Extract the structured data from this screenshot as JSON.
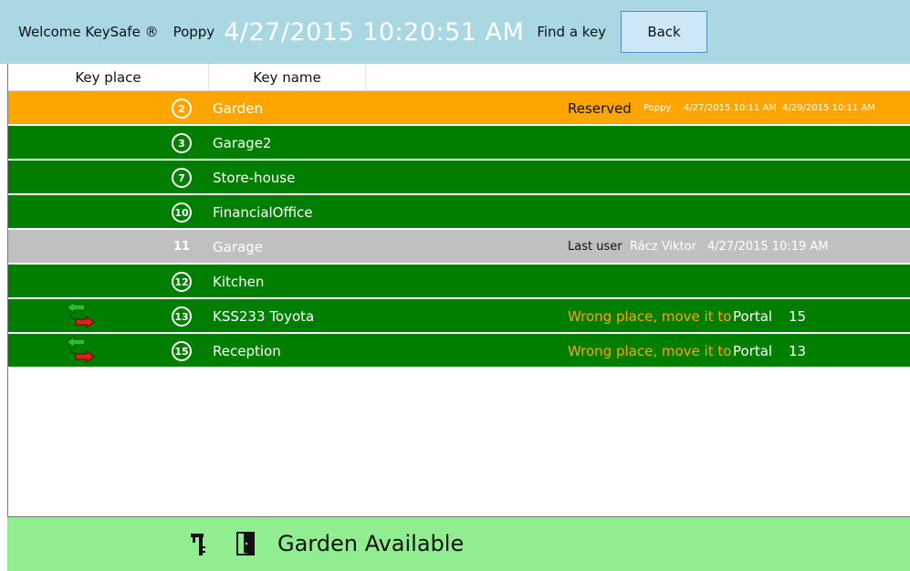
{
  "header": {
    "welcome": "Welcome KeySafe ®",
    "user": "Poppy",
    "datetime": "4/27/2015  10:20:51 AM",
    "find_key": "Find a key",
    "back_label": "Back"
  },
  "columns": {
    "key_place": "Key place",
    "key_name": "Key name"
  },
  "rows": [
    {
      "number": "2",
      "name": "Garden",
      "status": "Reserved",
      "color": "#ffa500",
      "reserved_by": "Poppy",
      "reserved_from": "4/27/2015 10:11 AM",
      "reserved_to": "4/29/2015 10:11 AM"
    },
    {
      "number": "3",
      "name": "Garage2",
      "color": "#007e00"
    },
    {
      "number": "7",
      "name": "Store-house",
      "color": "#007e00"
    },
    {
      "number": "10",
      "name": "FinancialOffice",
      "color": "#007e00"
    },
    {
      "number": "11",
      "name": "Garage",
      "color": "#c0c0c0",
      "last_user_label": "Last user",
      "last_user": "Rácz Viktor",
      "last_time": "4/27/2015 10:19 AM"
    },
    {
      "number": "12",
      "name": "Kitchen",
      "color": "#007e00"
    },
    {
      "number": "13",
      "name": "KSS233 Toyota",
      "color": "#007e00",
      "swap_icon": "swap-arrows-icon",
      "wrong_place": "Wrong place, move it to",
      "portal_label": "Portal",
      "portal_number": "15"
    },
    {
      "number": "15",
      "name": "Reception",
      "color": "#007e00",
      "swap_icon": "swap-arrows-icon",
      "wrong_place": "Wrong place, move it to",
      "portal_label": "Portal",
      "portal_number": "13"
    }
  ],
  "footer": {
    "key_icon": "key-icon",
    "door_icon": "door-icon",
    "status": "Garden Available",
    "color": "#90ee90"
  },
  "colors": {
    "header_bg": "#a9d8e3",
    "available": "#007e00",
    "reserved": "#ffa500",
    "in_use": "#c0c0c0"
  }
}
